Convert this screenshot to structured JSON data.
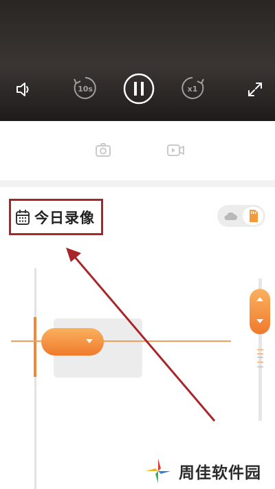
{
  "player": {
    "controls": {
      "volume": "speaker-icon",
      "rewind_label": "10s",
      "pause": "pause-icon",
      "speed_label": "x1",
      "fullscreen": "fullscreen-icon"
    }
  },
  "actions": {
    "snapshot": "camera-icon",
    "record": "video-record-icon"
  },
  "recordings": {
    "title": "今日录像",
    "source_toggle": {
      "options": [
        "cloud",
        "sd-card"
      ],
      "selected": "sd-card"
    }
  },
  "colors": {
    "accent": "#f08a3a",
    "annotation": "#a8262a"
  },
  "watermark": {
    "text": "周佳软件园"
  }
}
